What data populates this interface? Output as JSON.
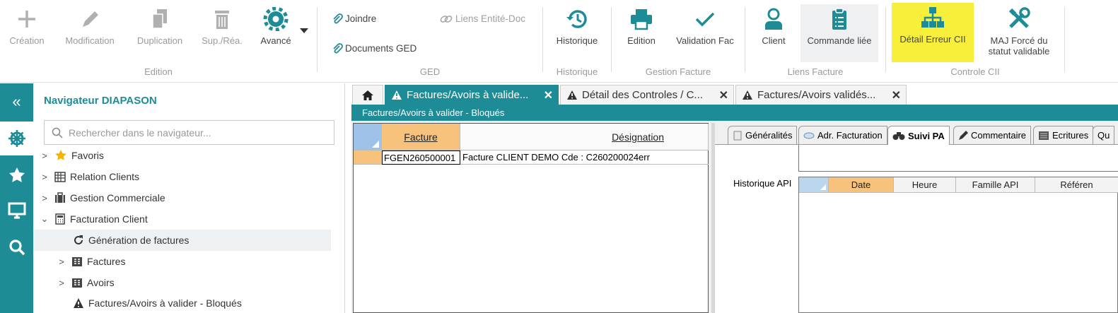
{
  "ribbon": {
    "edition": {
      "label": "Edition",
      "buttons": [
        {
          "label": "Création",
          "icon": "plus-icon"
        },
        {
          "label": "Modification",
          "icon": "pencil-icon"
        },
        {
          "label": "Duplication",
          "icon": "duplicate-icon"
        },
        {
          "label": "Sup./Réa.",
          "icon": "trash-icon"
        },
        {
          "label": "Avancé",
          "icon": "gear-icon"
        }
      ]
    },
    "ged": {
      "label": "GED",
      "joindre": "Joindre",
      "liens": "Liens Entité-Doc",
      "documents": "Documents GED"
    },
    "historique": {
      "label": "Historique",
      "button": "Historique"
    },
    "gestion_facture": {
      "label": "Gestion Facture",
      "edition": "Edition",
      "validation": "Validation Fac"
    },
    "liens_facture": {
      "label": "Liens Facture",
      "client": "Client",
      "commande": "Commande liée"
    },
    "controle": {
      "label": "Controle CII",
      "detail": "Détail Erreur CII",
      "maj_line1": "MAJ Forcé du",
      "maj_line2": "statut validable"
    },
    "colors": {
      "accent": "#1d8c96",
      "highlight": "#f7ef3a"
    }
  },
  "navigator": {
    "title": "Navigateur DIAPASON",
    "search_placeholder": "Rechercher dans le navigateur...",
    "items": [
      {
        "label": "Favoris"
      },
      {
        "label": "Relation Clients"
      },
      {
        "label": "Gestion Commerciale"
      },
      {
        "label": "Facturation Client"
      },
      {
        "label": "Génération de factures"
      },
      {
        "label": "Factures"
      },
      {
        "label": "Avoirs"
      },
      {
        "label": "Factures/Avoirs à valider - Bloqués"
      }
    ]
  },
  "tabs": [
    {
      "label": "Factures/Avoirs à valide..."
    },
    {
      "label": "Détail des Controles / C..."
    },
    {
      "label": "Factures/Avoirs validés..."
    }
  ],
  "subtitle": "Factures/Avoirs à valider - Bloqués",
  "grid": {
    "headers": [
      "Facture",
      "Désignation"
    ],
    "row": {
      "facture": "FGEN260500001",
      "designation": "Facture CLIENT DEMO  Cde : C260200024err"
    }
  },
  "right_pane": {
    "tabs": [
      "Généralités",
      "Adr. Facturation",
      "Suivi PA",
      "Commentaire",
      "Ecritures",
      "Qu"
    ],
    "history_label": "Historique API",
    "columns": [
      "Date",
      "Heure",
      "Famille API",
      "Référen"
    ]
  }
}
